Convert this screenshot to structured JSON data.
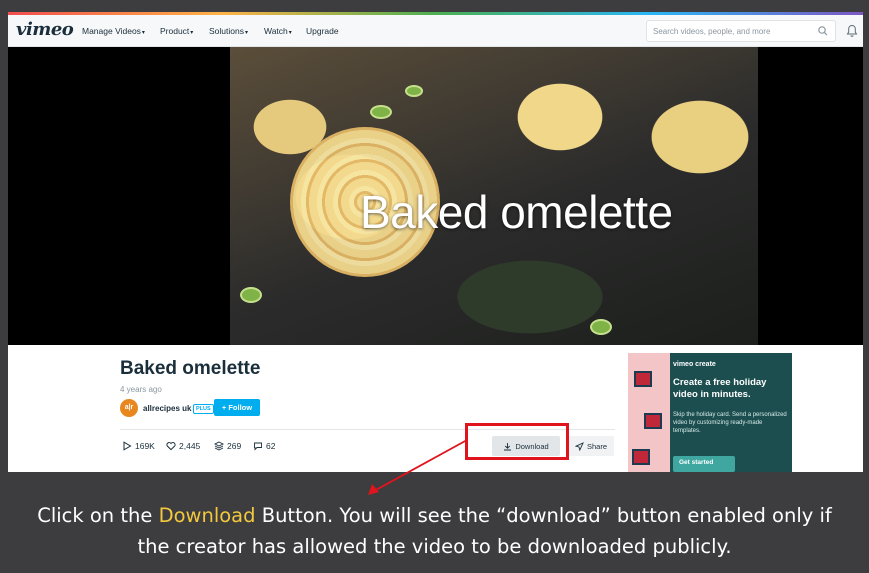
{
  "nav": {
    "logo": "vimeo",
    "items": [
      {
        "label": "Manage Videos",
        "has_chevron": true
      },
      {
        "label": "Product",
        "has_chevron": true
      },
      {
        "label": "Solutions",
        "has_chevron": true
      },
      {
        "label": "Watch",
        "has_chevron": true
      },
      {
        "label": "Upgrade",
        "has_chevron": false
      }
    ],
    "search_placeholder": "Search videos, people, and more",
    "icons": {
      "search": "search-icon",
      "notifications": "bell-icon"
    }
  },
  "player": {
    "overlay_title": "Baked omelette"
  },
  "video": {
    "title": "Baked omelette",
    "age": "4 years ago",
    "author": {
      "name": "allrecipes uk",
      "avatar_text": "a|r",
      "badge": "PLUS"
    },
    "follow_label": "+ Follow",
    "stats": {
      "plays": "169K",
      "likes": "2,445",
      "collections": "269",
      "comments": "62"
    },
    "download_label": "Download",
    "share_label": "Share"
  },
  "ad": {
    "brand": "vimeo create",
    "headline": "Create a free holiday video in minutes.",
    "body": "Skip the holiday card. Send a personalized video by customizing ready-made templates.",
    "cta": "Get started"
  },
  "caption": {
    "line1_prefix": "Click on the ",
    "line1_highlight": "Download",
    "line1_suffix": " Button. You will see the “download” button enabled only if",
    "line2": "the creator has allowed the video to be downloaded publicly."
  },
  "colors": {
    "brand_dark": "#1a2e3b",
    "accent_blue": "#00adef",
    "highlight_red": "#e0141c",
    "caption_highlight": "#f3c83d",
    "ad_bg": "#1d4e4f"
  }
}
